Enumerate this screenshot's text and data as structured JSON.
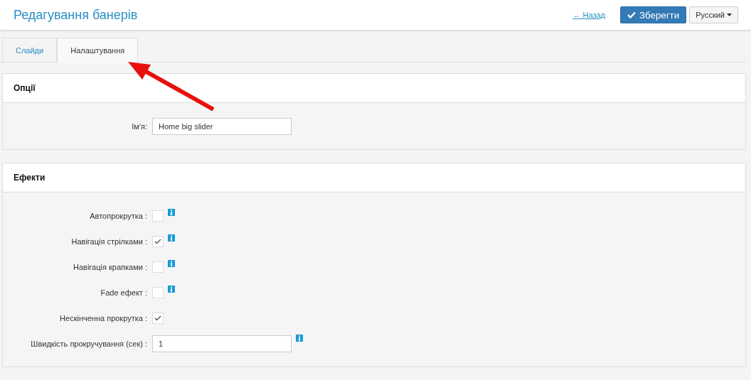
{
  "header": {
    "title": "Редагування банерів",
    "back_link": "← Назад",
    "save_button": "Зберегти",
    "language": "Русский"
  },
  "tabs": [
    {
      "label": "Слайди",
      "selected": false
    },
    {
      "label": "Налаштування",
      "selected": true
    }
  ],
  "panels": [
    {
      "title": "Опції",
      "rows": [
        {
          "kind": "text",
          "label": "Ім'я:",
          "value": "Home big slider",
          "info": false
        }
      ]
    },
    {
      "title": "Ефекти",
      "rows": [
        {
          "kind": "checkbox",
          "label": "Автопрокрутка :",
          "checked": false,
          "info": true
        },
        {
          "kind": "checkbox",
          "label": "Навігація стрілками :",
          "checked": true,
          "info": true
        },
        {
          "kind": "checkbox",
          "label": "Навігація крапками :",
          "checked": false,
          "info": true
        },
        {
          "kind": "checkbox",
          "label": "Fade ефект :",
          "checked": false,
          "info": true
        },
        {
          "kind": "checkbox",
          "label": "Нескінченна прокрутка :",
          "checked": true,
          "info": false
        },
        {
          "kind": "text",
          "label": "Швидкість прокручування (сек) :",
          "value": "1",
          "info": true
        }
      ]
    }
  ]
}
